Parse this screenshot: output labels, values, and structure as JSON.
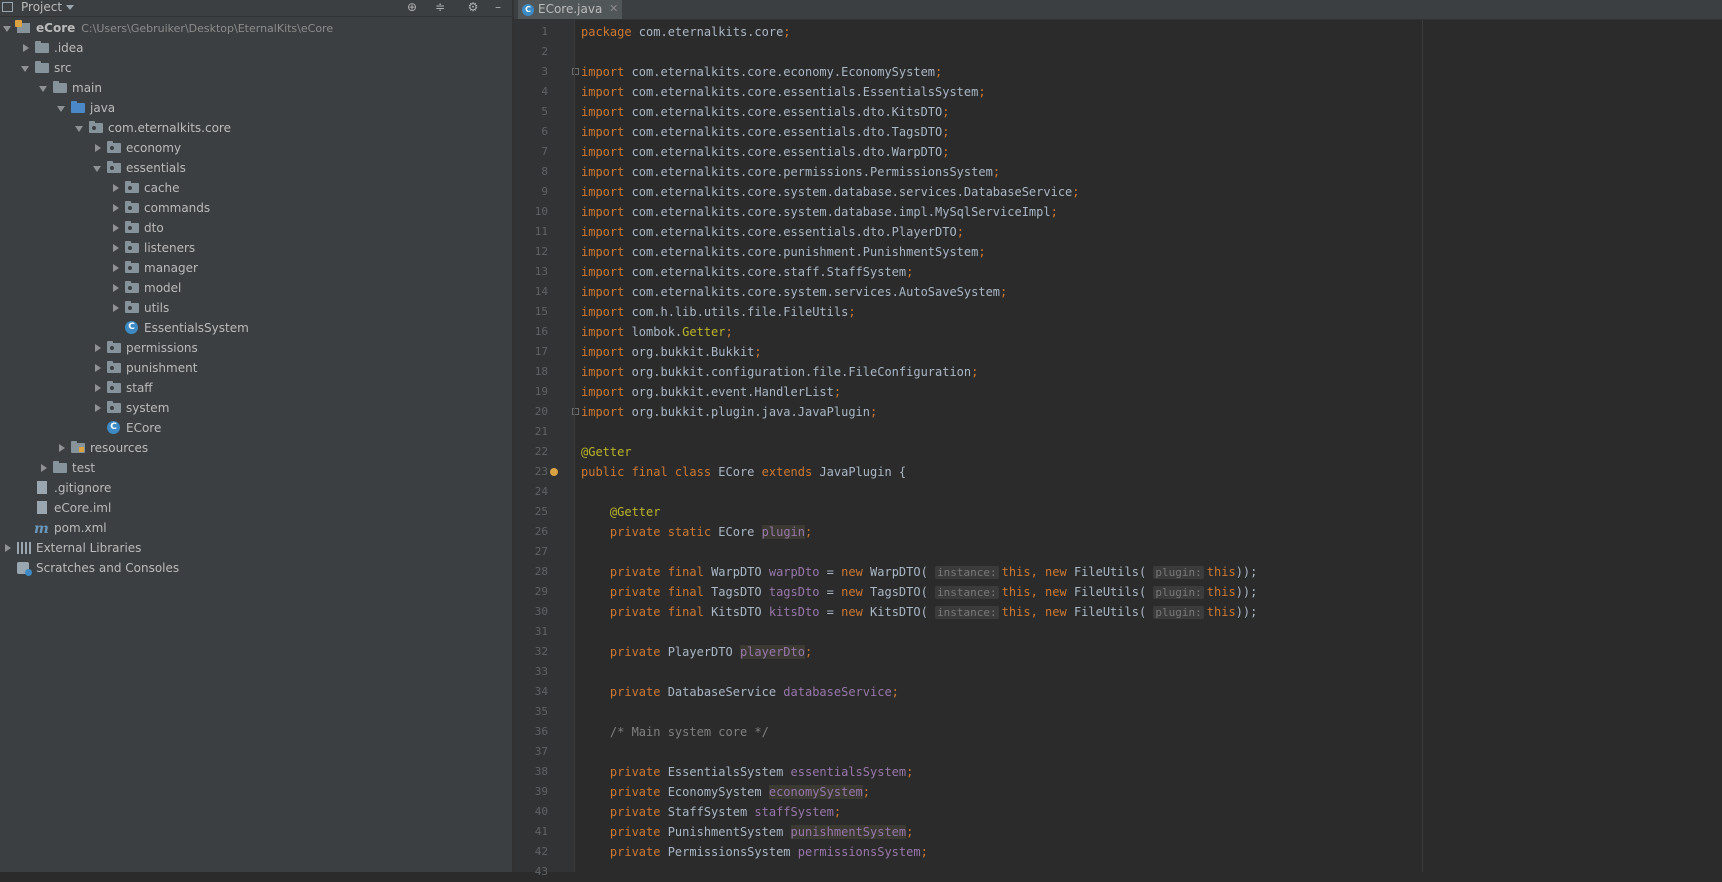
{
  "project_panel": {
    "title": "Project",
    "tree": [
      {
        "label": "eCore",
        "path": "C:\\Users\\Gebruiker\\Desktop\\EternalKits\\eCore",
        "depth": 0,
        "arrow": "down",
        "icon": "module-icon"
      },
      {
        "label": ".idea",
        "depth": 1,
        "arrow": "right",
        "icon": "folder-icon"
      },
      {
        "label": "src",
        "depth": 1,
        "arrow": "down",
        "icon": "folder-icon"
      },
      {
        "label": "main",
        "depth": 2,
        "arrow": "down",
        "icon": "folder-icon"
      },
      {
        "label": "java",
        "depth": 3,
        "arrow": "down",
        "icon": "source-folder-icon"
      },
      {
        "label": "com.eternalkits.core",
        "depth": 4,
        "arrow": "down",
        "icon": "package-icon"
      },
      {
        "label": "economy",
        "depth": 5,
        "arrow": "right",
        "icon": "package-icon"
      },
      {
        "label": "essentials",
        "depth": 5,
        "arrow": "down",
        "icon": "package-icon"
      },
      {
        "label": "cache",
        "depth": 6,
        "arrow": "right",
        "icon": "package-icon"
      },
      {
        "label": "commands",
        "depth": 6,
        "arrow": "right",
        "icon": "package-icon"
      },
      {
        "label": "dto",
        "depth": 6,
        "arrow": "right",
        "icon": "package-icon"
      },
      {
        "label": "listeners",
        "depth": 6,
        "arrow": "right",
        "icon": "package-icon"
      },
      {
        "label": "manager",
        "depth": 6,
        "arrow": "right",
        "icon": "package-icon"
      },
      {
        "label": "model",
        "depth": 6,
        "arrow": "right",
        "icon": "package-icon"
      },
      {
        "label": "utils",
        "depth": 6,
        "arrow": "right",
        "icon": "package-icon"
      },
      {
        "label": "EssentialsSystem",
        "depth": 6,
        "arrow": "none",
        "icon": "java-class-icon"
      },
      {
        "label": "permissions",
        "depth": 5,
        "arrow": "right",
        "icon": "package-icon"
      },
      {
        "label": "punishment",
        "depth": 5,
        "arrow": "right",
        "icon": "package-icon"
      },
      {
        "label": "staff",
        "depth": 5,
        "arrow": "right",
        "icon": "package-icon"
      },
      {
        "label": "system",
        "depth": 5,
        "arrow": "right",
        "icon": "package-icon"
      },
      {
        "label": "ECore",
        "depth": 5,
        "arrow": "none",
        "icon": "java-class-icon"
      },
      {
        "label": "resources",
        "depth": 3,
        "arrow": "right",
        "icon": "resources-folder-icon"
      },
      {
        "label": "test",
        "depth": 2,
        "arrow": "right",
        "icon": "folder-icon"
      },
      {
        "label": ".gitignore",
        "depth": 1,
        "arrow": "none",
        "icon": "file-icon"
      },
      {
        "label": "eCore.iml",
        "depth": 1,
        "arrow": "none",
        "icon": "file-icon"
      },
      {
        "label": "pom.xml",
        "depth": 1,
        "arrow": "none",
        "icon": "maven-icon"
      },
      {
        "label": "External Libraries",
        "depth": 0,
        "arrow": "right",
        "icon": "libraries-icon"
      },
      {
        "label": "Scratches and Consoles",
        "depth": 0,
        "arrow": "none",
        "icon": "scratches-icon"
      }
    ]
  },
  "editor": {
    "tab_label": "ECore.java",
    "tab_icon": "C",
    "colors": {
      "keyword": "#cc7832",
      "annotation": "#bbb529",
      "field": "#9876aa",
      "text": "#a9b7c6",
      "comment": "#808080"
    },
    "lines": [
      [
        {
          "t": "package ",
          "c": "kw"
        },
        {
          "t": "com.eternalkits.core"
        },
        {
          "t": ";",
          "c": "kw"
        }
      ],
      [],
      [
        {
          "t": "import ",
          "c": "kw"
        },
        {
          "t": "com.eternalkits.core.economy.EconomySystem"
        },
        {
          "t": ";",
          "c": "kw"
        }
      ],
      [
        {
          "t": "import ",
          "c": "kw"
        },
        {
          "t": "com.eternalkits.core.essentials.EssentialsSystem"
        },
        {
          "t": ";",
          "c": "kw"
        }
      ],
      [
        {
          "t": "import ",
          "c": "kw"
        },
        {
          "t": "com.eternalkits.core.essentials.dto.KitsDTO"
        },
        {
          "t": ";",
          "c": "kw"
        }
      ],
      [
        {
          "t": "import ",
          "c": "kw"
        },
        {
          "t": "com.eternalkits.core.essentials.dto.TagsDTO"
        },
        {
          "t": ";",
          "c": "kw"
        }
      ],
      [
        {
          "t": "import ",
          "c": "kw"
        },
        {
          "t": "com.eternalkits.core.essentials.dto.WarpDTO"
        },
        {
          "t": ";",
          "c": "kw"
        }
      ],
      [
        {
          "t": "import ",
          "c": "kw"
        },
        {
          "t": "com.eternalkits.core.permissions.PermissionsSystem"
        },
        {
          "t": ";",
          "c": "kw"
        }
      ],
      [
        {
          "t": "import ",
          "c": "kw"
        },
        {
          "t": "com.eternalkits.core.system.database.services.DatabaseService"
        },
        {
          "t": ";",
          "c": "kw"
        }
      ],
      [
        {
          "t": "import ",
          "c": "kw"
        },
        {
          "t": "com.eternalkits.core.system.database.impl.MySqlServiceImpl"
        },
        {
          "t": ";",
          "c": "kw"
        }
      ],
      [
        {
          "t": "import ",
          "c": "kw"
        },
        {
          "t": "com.eternalkits.core.essentials.dto.PlayerDTO"
        },
        {
          "t": ";",
          "c": "kw"
        }
      ],
      [
        {
          "t": "import ",
          "c": "kw"
        },
        {
          "t": "com.eternalkits.core.punishment.PunishmentSystem"
        },
        {
          "t": ";",
          "c": "kw"
        }
      ],
      [
        {
          "t": "import ",
          "c": "kw"
        },
        {
          "t": "com.eternalkits.core.staff.StaffSystem"
        },
        {
          "t": ";",
          "c": "kw"
        }
      ],
      [
        {
          "t": "import ",
          "c": "kw"
        },
        {
          "t": "com.eternalkits.core.system.services.AutoSaveSystem"
        },
        {
          "t": ";",
          "c": "kw"
        }
      ],
      [
        {
          "t": "import ",
          "c": "kw"
        },
        {
          "t": "com.h.lib.utils.file.FileUtils"
        },
        {
          "t": ";",
          "c": "kw"
        }
      ],
      [
        {
          "t": "import ",
          "c": "kw"
        },
        {
          "t": "lombok."
        },
        {
          "t": "Getter",
          "c": "ann"
        },
        {
          "t": ";",
          "c": "kw"
        }
      ],
      [
        {
          "t": "import ",
          "c": "kw"
        },
        {
          "t": "org.bukkit.Bukkit"
        },
        {
          "t": ";",
          "c": "kw"
        }
      ],
      [
        {
          "t": "import ",
          "c": "kw"
        },
        {
          "t": "org.bukkit.configuration.file.FileConfiguration"
        },
        {
          "t": ";",
          "c": "kw"
        }
      ],
      [
        {
          "t": "import ",
          "c": "kw"
        },
        {
          "t": "org.bukkit.event.HandlerList"
        },
        {
          "t": ";",
          "c": "kw"
        }
      ],
      [
        {
          "t": "import ",
          "c": "kw"
        },
        {
          "t": "org.bukkit.plugin.java.JavaPlugin"
        },
        {
          "t": ";",
          "c": "kw"
        }
      ],
      [],
      [
        {
          "t": "@Getter",
          "c": "ann"
        }
      ],
      [
        {
          "t": "public final class ",
          "c": "kw"
        },
        {
          "t": "ECore "
        },
        {
          "t": "extends ",
          "c": "kw"
        },
        {
          "t": "JavaPlugin {"
        }
      ],
      [],
      [
        {
          "t": "    "
        },
        {
          "t": "@Getter",
          "c": "ann"
        }
      ],
      [
        {
          "t": "    "
        },
        {
          "t": "private static ",
          "c": "kw"
        },
        {
          "t": "ECore "
        },
        {
          "t": "plugin",
          "c": "fldu"
        },
        {
          "t": ";",
          "c": "kw"
        }
      ],
      [],
      [
        {
          "t": "    "
        },
        {
          "t": "private final ",
          "c": "kw"
        },
        {
          "t": "WarpDTO "
        },
        {
          "t": "warpDto",
          "c": "fld"
        },
        {
          "t": " = "
        },
        {
          "t": "new ",
          "c": "kw"
        },
        {
          "t": "WarpDTO( "
        },
        {
          "t": "instance:",
          "c": "hint"
        },
        {
          "t": "this",
          "c": "kw"
        },
        {
          "t": ", ",
          "c": "kw"
        },
        {
          "t": "new ",
          "c": "kw"
        },
        {
          "t": "FileUtils( "
        },
        {
          "t": "plugin:",
          "c": "hint"
        },
        {
          "t": "this",
          "c": "kw"
        },
        {
          "t": "));"
        }
      ],
      [
        {
          "t": "    "
        },
        {
          "t": "private final ",
          "c": "kw"
        },
        {
          "t": "TagsDTO "
        },
        {
          "t": "tagsDto",
          "c": "fld"
        },
        {
          "t": " = "
        },
        {
          "t": "new ",
          "c": "kw"
        },
        {
          "t": "TagsDTO( "
        },
        {
          "t": "instance:",
          "c": "hint"
        },
        {
          "t": "this",
          "c": "kw"
        },
        {
          "t": ", ",
          "c": "kw"
        },
        {
          "t": "new ",
          "c": "kw"
        },
        {
          "t": "FileUtils( "
        },
        {
          "t": "plugin:",
          "c": "hint"
        },
        {
          "t": "this",
          "c": "kw"
        },
        {
          "t": "));"
        }
      ],
      [
        {
          "t": "    "
        },
        {
          "t": "private final ",
          "c": "kw"
        },
        {
          "t": "KitsDTO "
        },
        {
          "t": "kitsDto",
          "c": "fld"
        },
        {
          "t": " = "
        },
        {
          "t": "new ",
          "c": "kw"
        },
        {
          "t": "KitsDTO( "
        },
        {
          "t": "instance:",
          "c": "hint"
        },
        {
          "t": "this",
          "c": "kw"
        },
        {
          "t": ", ",
          "c": "kw"
        },
        {
          "t": "new ",
          "c": "kw"
        },
        {
          "t": "FileUtils( "
        },
        {
          "t": "plugin:",
          "c": "hint"
        },
        {
          "t": "this",
          "c": "kw"
        },
        {
          "t": "));"
        }
      ],
      [],
      [
        {
          "t": "    "
        },
        {
          "t": "private ",
          "c": "kw"
        },
        {
          "t": "PlayerDTO "
        },
        {
          "t": "playerDto",
          "c": "fldu"
        },
        {
          "t": ";",
          "c": "kw"
        }
      ],
      [],
      [
        {
          "t": "    "
        },
        {
          "t": "private ",
          "c": "kw"
        },
        {
          "t": "DatabaseService "
        },
        {
          "t": "databaseService",
          "c": "fld"
        },
        {
          "t": ";",
          "c": "kw"
        }
      ],
      [],
      [
        {
          "t": "    "
        },
        {
          "t": "/* Main system core */",
          "c": "cmt"
        }
      ],
      [],
      [
        {
          "t": "    "
        },
        {
          "t": "private ",
          "c": "kw"
        },
        {
          "t": "EssentialsSystem "
        },
        {
          "t": "essentialsSystem",
          "c": "fld"
        },
        {
          "t": ";",
          "c": "kw"
        }
      ],
      [
        {
          "t": "    "
        },
        {
          "t": "private ",
          "c": "kw"
        },
        {
          "t": "EconomySystem "
        },
        {
          "t": "economySystem",
          "c": "fldu"
        },
        {
          "t": ";",
          "c": "kw"
        }
      ],
      [
        {
          "t": "    "
        },
        {
          "t": "private ",
          "c": "kw"
        },
        {
          "t": "StaffSystem "
        },
        {
          "t": "staffSystem",
          "c": "fld"
        },
        {
          "t": ";",
          "c": "kw"
        }
      ],
      [
        {
          "t": "    "
        },
        {
          "t": "private ",
          "c": "kw"
        },
        {
          "t": "PunishmentSystem "
        },
        {
          "t": "punishmentSystem",
          "c": "fldu"
        },
        {
          "t": ";",
          "c": "kw"
        }
      ],
      [
        {
          "t": "    "
        },
        {
          "t": "private ",
          "c": "kw"
        },
        {
          "t": "PermissionsSystem "
        },
        {
          "t": "permissionsSystem",
          "c": "fld"
        },
        {
          "t": ";",
          "c": "kw"
        }
      ]
    ],
    "line_count": 43
  }
}
